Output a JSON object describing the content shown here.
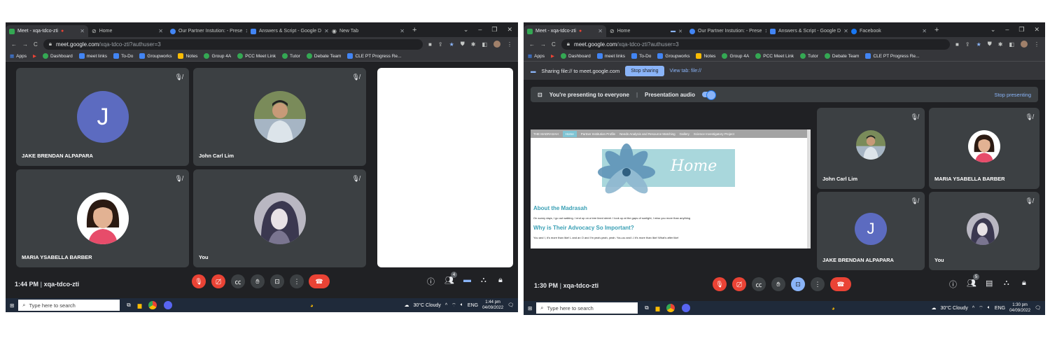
{
  "left": {
    "tabs": [
      {
        "label": "Meet - xqa-tdco-zti",
        "color": "#34a853",
        "active": true,
        "rec": true
      },
      {
        "label": "Home",
        "color": "#9aa0a6"
      },
      {
        "label": "Our Partner Instution: - Prese",
        "color": "#4285f4"
      },
      {
        "label": "Answers & Script - Google D",
        "color": "#4285f4"
      },
      {
        "label": "New Tab",
        "color": "#9aa0a6"
      }
    ],
    "url_host": "meet.google.com",
    "url_path": "/xqa-tdco-zti?authuser=3",
    "bookmarks": [
      "Apps",
      "Dashboard",
      "meet links",
      "To-Do",
      "Groupworks",
      "Notes",
      "Group 4A",
      "PCC Meet Link",
      "Tutor",
      "Debate Team",
      "CLE PT Progress Re..."
    ],
    "participants": {
      "jake": "JAKE BRENDAN ALPAPARA",
      "john": "John Carl Lim",
      "maria": "MARIA YSABELLA BARBER",
      "you": "You"
    },
    "avatar_letter": "J",
    "time": "1:44 PM",
    "separator": "|",
    "meeting_code": "xqa-tdco-zti",
    "people_count": "4",
    "taskbar": {
      "search": "Type here to search",
      "weather": "30°C Cloudy",
      "lang": "ENG",
      "clock_time": "1:44 pm",
      "clock_date": "04/09/2022"
    }
  },
  "right": {
    "tabs": [
      {
        "label": "Meet - xqa-tdco-zti",
        "color": "#34a853",
        "active": true,
        "rec": true
      },
      {
        "label": "Home",
        "color": "#9aa0a6"
      },
      {
        "label": "Our Partner Instution: - Prese",
        "color": "#4285f4"
      },
      {
        "label": "Answers & Script - Google D",
        "color": "#4285f4"
      },
      {
        "label": "Facebook",
        "color": "#1877f2"
      }
    ],
    "url_host": "meet.google.com",
    "url_path": "/xqa-tdco-zti?authuser=3",
    "bookmarks": [
      "Apps",
      "Dashboard",
      "meet links",
      "To-Do",
      "Groupworks",
      "Notes",
      "Group 4A",
      "PCC Meet Link",
      "Tutor",
      "Debate Team",
      "CLE PT Progress Re..."
    ],
    "sharing_text": "Sharing file:// to meet.google.com",
    "stop_sharing": "Stop sharing",
    "view_tab": "View tab: file://",
    "presenting": "You're presenting to everyone",
    "presentation_audio": "Presentation audio",
    "stop_presenting": "Stop presenting",
    "site": {
      "nav": [
        "THE MADRASAH",
        "Home",
        "Partner Institution Profile",
        "Needs Analysis and Resource Matching",
        "Gallery",
        "Science Investigatory Project"
      ],
      "banner": "Home",
      "h1": "About the Madrasah",
      "p1": "On sunny days, I go out walking. I end up on a tree lined street. I look up at the gaps of sunlight, I miss you more than anything",
      "h2": "Why is Their Advocacy So Important?",
      "p2": "You and I, it's more than like! L and an O and I'm yeah-yeah, yeah. You-ou and I-I it's more than like! What's after like!"
    },
    "participants": {
      "john": "John Carl Lim",
      "maria": "MARIA YSABELLA BARBER",
      "jake": "JAKE BRENDAN ALPAPARA",
      "you": "You"
    },
    "avatar_letter": "J",
    "time": "1:30 PM",
    "separator": "|",
    "meeting_code": "xqa-tdco-zti",
    "people_count": "5",
    "taskbar": {
      "search": "Type here to search",
      "weather": "30°C Cloudy",
      "lang": "ENG",
      "clock_time": "1:30 pm",
      "clock_date": "04/09/2022"
    }
  }
}
